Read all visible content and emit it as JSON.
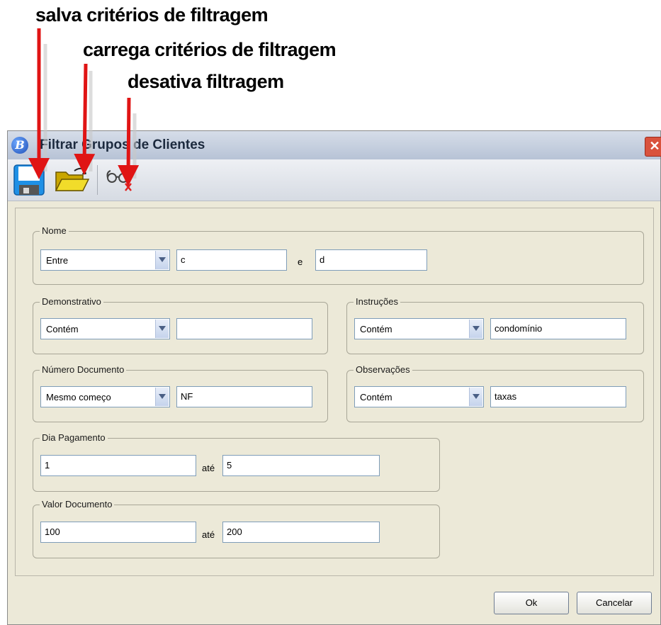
{
  "annotations": {
    "save": "salva critérios de filtragem",
    "load": "carrega critérios de filtragem",
    "disable": "desativa filtragem"
  },
  "window": {
    "title": "Filtrar Grupos de Clientes",
    "app_icon_letter": "B",
    "close_glyph": "✕"
  },
  "toolbar": {
    "icons": [
      "save-disk-icon",
      "open-folder-icon",
      "disable-filter-icon"
    ]
  },
  "form": {
    "nome": {
      "label": "Nome",
      "operator": "Entre",
      "value1": "c",
      "connector": "e",
      "value2": "d"
    },
    "demonstrativo": {
      "label": "Demonstrativo",
      "operator": "Contém",
      "value": ""
    },
    "instrucoes": {
      "label": "Instruções",
      "operator": "Contém",
      "value": "condomínio"
    },
    "numero_documento": {
      "label": "Número Documento",
      "operator": "Mesmo começo",
      "value": "NF"
    },
    "observacoes": {
      "label": "Observações",
      "operator": "Contém",
      "value": "taxas"
    },
    "dia_pagamento": {
      "label": "Dia Pagamento",
      "from": "1",
      "connector": "até",
      "to": "5"
    },
    "valor_documento": {
      "label": "Valor Documento",
      "from": "100",
      "connector": "até",
      "to": "200"
    }
  },
  "buttons": {
    "ok": "Ok",
    "cancel": "Cancelar"
  },
  "colors": {
    "arrow": "#e01414",
    "window_bg": "#ece9d8",
    "input_border": "#7f9db9"
  }
}
